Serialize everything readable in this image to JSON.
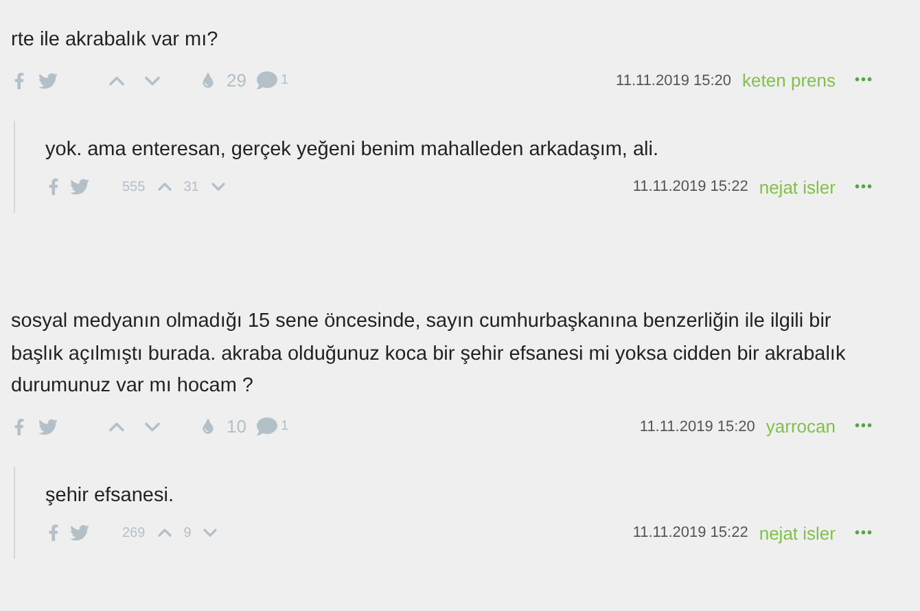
{
  "posts": [
    {
      "kind": "entry",
      "text": "rte ile akrabalık var mı?",
      "favorites": "29",
      "comments": "1",
      "date": "11.11.2019 15:20",
      "author": "keten prens",
      "menu": "•••"
    },
    {
      "kind": "reply",
      "text": "yok. ama enteresan, gerçek yeğeni benim mahalleden arkadaşım, ali.",
      "upvotes": "555",
      "downvotes": "31",
      "date": "11.11.2019 15:22",
      "author": "nejat isler",
      "menu": "•••"
    },
    {
      "kind": "entry",
      "text": "sosyal medyanın olmadığı 15 sene öncesinde, sayın cumhurbaşkanına benzerliğin ile ilgili bir başlık açılmıştı burada. akraba olduğunuz koca bir şehir efsanesi mi yoksa cidden bir akrabalık durumunuz var mı hocam ?",
      "favorites": "10",
      "comments": "1",
      "date": "11.11.2019 15:20",
      "author": "yarrocan",
      "menu": "•••"
    },
    {
      "kind": "reply",
      "text": "şehir efsanesi.",
      "upvotes": "269",
      "downvotes": "9",
      "date": "11.11.2019 15:22",
      "author": "nejat isler",
      "menu": "•••"
    }
  ]
}
